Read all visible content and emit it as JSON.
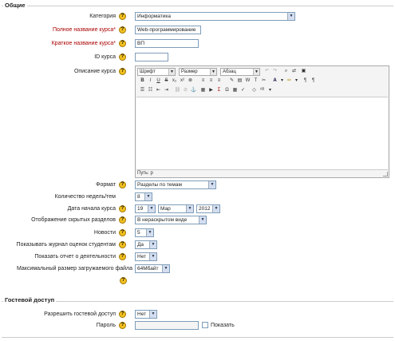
{
  "general": {
    "legend": "Общие",
    "category_label": "Категория",
    "category_value": "Информатика",
    "fullname_label": "Полное название курса*",
    "fullname_value": "Web-программирование",
    "shortname_label": "Краткое название курса*",
    "shortname_value": "ВП",
    "idnumber_label": "ID курса",
    "idnumber_value": "",
    "summary_label": "Описание курса",
    "editor": {
      "font_select": "Шрифт",
      "size_select": "Размер",
      "format_select": "Абзац",
      "path_text": "Путь: p"
    },
    "format_label": "Формат",
    "format_value": "Разделы по темам",
    "numsections_label": "Количество недель/тем",
    "numsections_value": "8",
    "startdate_label": "Дата начала курса",
    "startdate_day": "19",
    "startdate_month": "Мар",
    "startdate_year": "2012",
    "hiddensections_label": "Отображение скрытых разделов",
    "hiddensections_value": "В нераскрытом виде",
    "news_label": "Новости",
    "news_value": "5",
    "showgrades_label": "Показывать журнал оценок студентам",
    "showgrades_value": "Да",
    "showreports_label": "Показать отчет о деятельности",
    "showreports_value": "Нет",
    "maxbytes_label": "Максимальный размер загружаемого файла",
    "maxbytes_value": "64Мбайт"
  },
  "guest": {
    "legend": "Гостевой доступ",
    "allow_label": "Разрешить гостевой доступ",
    "allow_value": "Нет",
    "password_label": "Пароль",
    "password_value": "",
    "show_label": "Показать"
  },
  "colors": {
    "required": "#aa0000",
    "help_icon": "#f2c020",
    "input_border": "#7f9db9"
  }
}
